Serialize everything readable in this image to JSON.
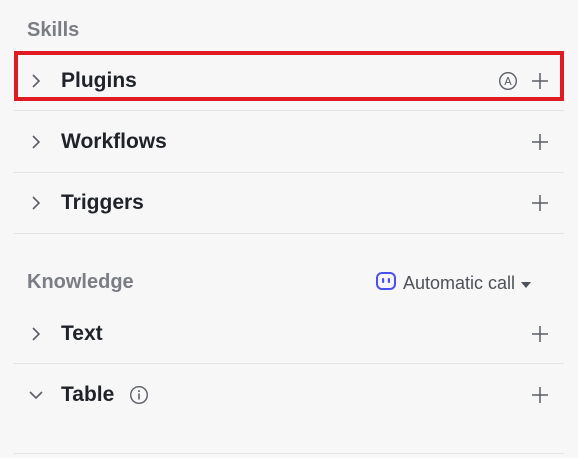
{
  "skills": {
    "title": "Skills",
    "items": [
      {
        "label": "Plugins"
      },
      {
        "label": "Workflows"
      },
      {
        "label": "Triggers"
      }
    ]
  },
  "knowledge": {
    "title": "Knowledge",
    "call_mode": "Automatic call",
    "items": [
      {
        "label": "Text"
      },
      {
        "label": "Table"
      }
    ]
  },
  "colors": {
    "highlight": "#e01b24",
    "accent": "#4b4ff0"
  },
  "icons": {
    "expand": "chevron-right-icon",
    "collapse": "chevron-down-icon",
    "add": "plus-icon",
    "auto": "auto-a-icon",
    "info": "info-icon",
    "robot": "robot-icon",
    "dropdown": "caret-down-icon"
  }
}
